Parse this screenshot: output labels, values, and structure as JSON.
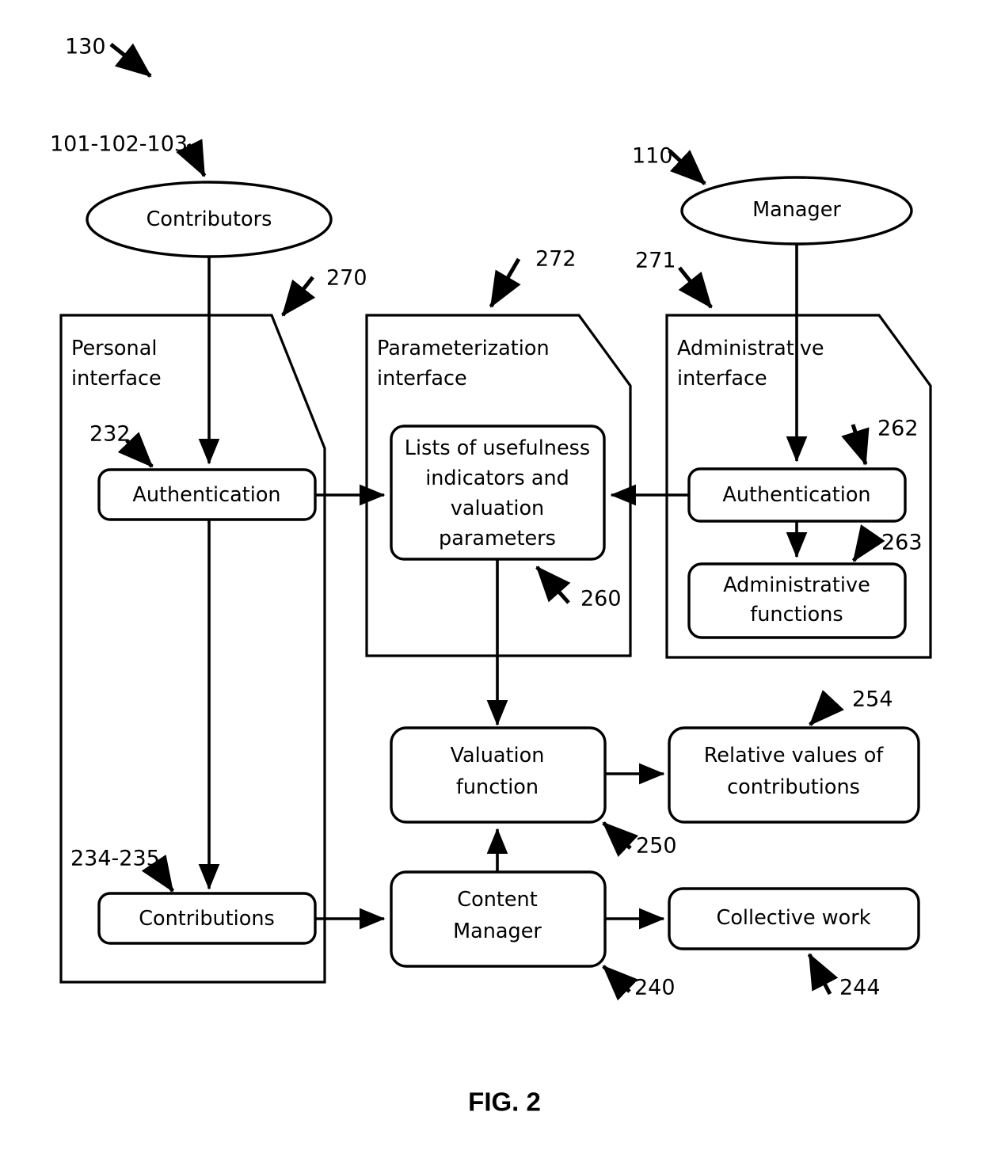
{
  "figure": {
    "caption": "FIG. 2",
    "top_reference": "130"
  },
  "actors": [
    {
      "id": "contributors",
      "label": "Contributors",
      "reference": "101-102-103"
    },
    {
      "id": "manager",
      "label": "Manager",
      "reference": "110"
    }
  ],
  "panels": [
    {
      "id": "personal-interface",
      "label_line1": "Personal",
      "label_line2": "interface",
      "reference": "270"
    },
    {
      "id": "parameterization-interface",
      "label_line1": "Parameterization",
      "label_line2": "interface",
      "reference": "272"
    },
    {
      "id": "administrative-interface",
      "label_line1": "Administrative",
      "label_line2": "interface",
      "reference": "271"
    }
  ],
  "nodes": [
    {
      "id": "personal-authentication",
      "label_line1": "Authentication",
      "label_line2": "",
      "reference": "232"
    },
    {
      "id": "contributions",
      "label_line1": "Contributions",
      "label_line2": "",
      "reference": "234-235"
    },
    {
      "id": "lists-of-usefulness",
      "label_line1": "Lists of usefulness",
      "label_line2": "indicators and",
      "label_line3": "valuation",
      "label_line4": "parameters",
      "reference": "260"
    },
    {
      "id": "admin-authentication",
      "label_line1": "Authentication",
      "label_line2": "",
      "reference": "262"
    },
    {
      "id": "administrative-functions",
      "label_line1": "Administrative",
      "label_line2": "functions",
      "reference": "263"
    },
    {
      "id": "valuation-function",
      "label_line1": "Valuation",
      "label_line2": "function",
      "reference": "250"
    },
    {
      "id": "relative-values",
      "label_line1": "Relative values of",
      "label_line2": "contributions",
      "reference": "254"
    },
    {
      "id": "content-manager",
      "label_line1": "Content",
      "label_line2": "Manager",
      "reference": "240"
    },
    {
      "id": "collective-work",
      "label_line1": "Collective work",
      "label_line2": "",
      "reference": "244"
    }
  ],
  "colors": {
    "stroke": "#000000",
    "background": "#ffffff"
  }
}
